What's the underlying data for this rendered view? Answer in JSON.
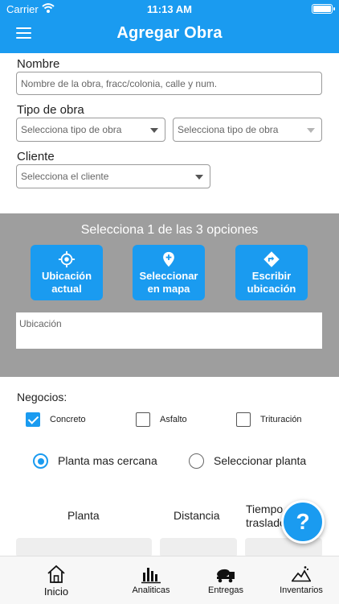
{
  "status_bar": {
    "carrier": "Carrier",
    "time": "11:13 AM"
  },
  "header": {
    "title": "Agregar Obra"
  },
  "form": {
    "nombre_label": "Nombre",
    "nombre_placeholder": "Nombre de la obra, fracc/colonia, calle y num.",
    "tipo_label": "Tipo de obra",
    "tipo_select_1": "Selecciona tipo de obra",
    "tipo_select_2": "Selecciona tipo de obra",
    "cliente_label": "Cliente",
    "cliente_select": "Selecciona el cliente"
  },
  "location": {
    "heading": "Selecciona 1 de las 3 opciones",
    "buttons": [
      {
        "line1": "Ubicación",
        "line2": "actual",
        "icon": "gps-icon"
      },
      {
        "line1": "Seleccionar",
        "line2": "en mapa",
        "icon": "map-pin-icon"
      },
      {
        "line1": "Escribir",
        "line2": "ubicación",
        "icon": "directions-icon"
      }
    ],
    "input_placeholder": "Ubicación"
  },
  "negocios": {
    "label": "Negocios:",
    "options": [
      {
        "label": "Concreto",
        "checked": true
      },
      {
        "label": "Asfalto",
        "checked": false
      },
      {
        "label": "Trituración",
        "checked": false
      }
    ]
  },
  "planta_mode": {
    "options": [
      {
        "label": "Planta mas cercana",
        "selected": true
      },
      {
        "label": "Seleccionar planta",
        "selected": false
      }
    ]
  },
  "table": {
    "columns": [
      "Planta",
      "Distancia",
      "Tiempo",
      "traslado"
    ]
  },
  "help_button": {
    "label": "?"
  },
  "tabbar": {
    "items": [
      {
        "label": "Inicio",
        "icon": "home-icon"
      },
      {
        "label": "Analiticas",
        "icon": "bar-chart-icon"
      },
      {
        "label": "Entregas",
        "icon": "mixer-truck-icon"
      },
      {
        "label": "Inventarios",
        "icon": "stockpile-icon"
      }
    ]
  },
  "colors": {
    "accent": "#1a9bf0",
    "section_gray": "#9e9e9e"
  }
}
